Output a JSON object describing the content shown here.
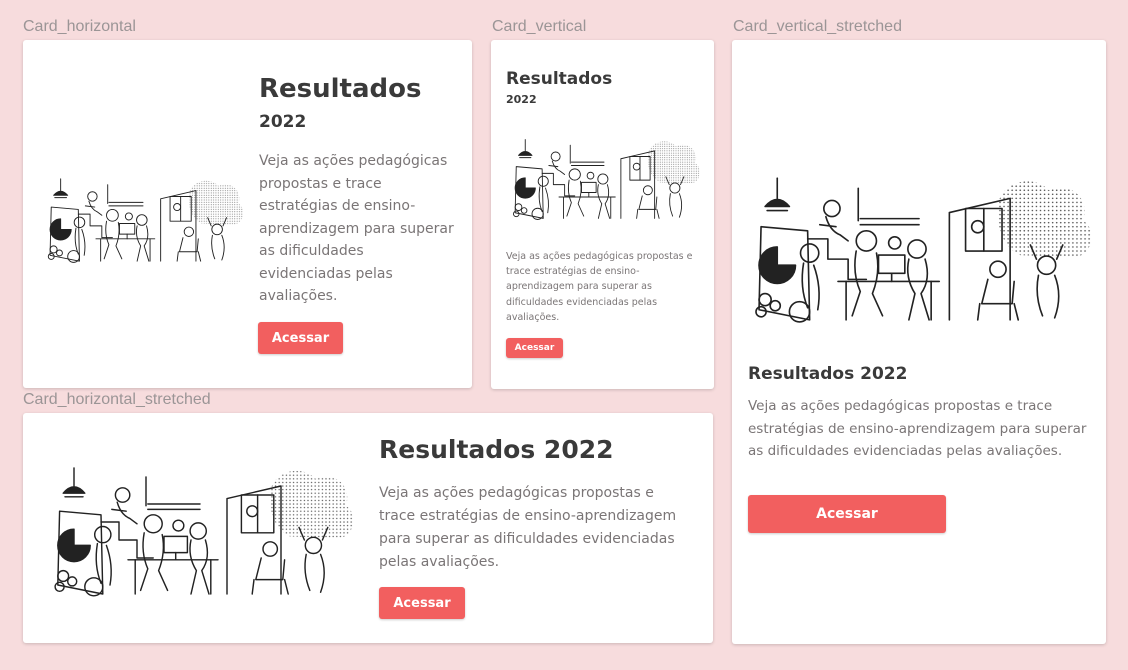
{
  "labels": {
    "card_horizontal": "Card_horizontal",
    "card_vertical": "Card_vertical",
    "card_vertical_stretched": "Card_vertical_stretched",
    "card_horizontal_stretched": "Card_horizontal_stretched"
  },
  "card_horizontal": {
    "title": "Resultados",
    "year": "2022",
    "description": "Veja as ações pedagógicas propostas e trace estratégias de ensino-aprendizagem para superar as dificuldades evidenciadas pelas avaliações.",
    "button": "Acessar"
  },
  "card_vertical": {
    "title": "Resultados",
    "year": "2022",
    "description": "Veja as ações pedagógicas propostas e trace estratégias de ensino-aprendizagem para superar as dificuldades evidenciadas pelas avaliações.",
    "button": "Acessar"
  },
  "card_vertical_stretched": {
    "title": "Resultados 2022",
    "description": "Veja as ações pedagógicas propostas e trace estratégias de ensino-aprendizagem para superar as dificuldades evidenciadas pelas avaliações.",
    "button": "Acessar"
  },
  "card_horizontal_stretched": {
    "title": "Resultados 2022",
    "description": "Veja as ações pedagógicas propostas e trace estratégias de ensino-aprendizagem para superar as dificuldades evidenciadas pelas avaliações.",
    "button": "Acessar"
  },
  "colors": {
    "background": "#f7dcdd",
    "button": "#f25f5f",
    "title": "#3a3a3a",
    "text": "#7a7576"
  },
  "icons": [
    "office-illustration"
  ]
}
